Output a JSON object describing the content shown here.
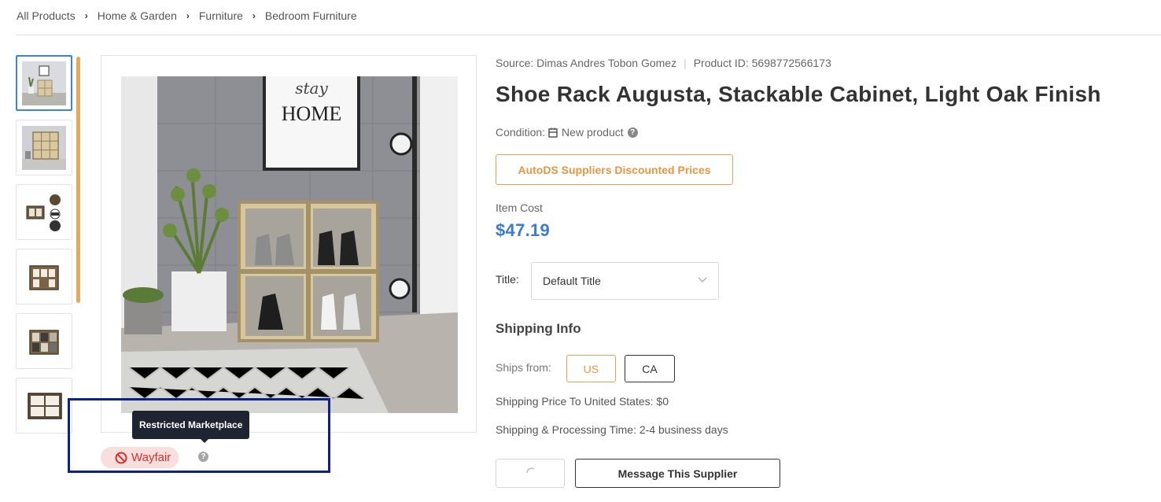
{
  "breadcrumb": {
    "items": [
      "All Products",
      "Home & Garden",
      "Furniture",
      "Bedroom Furniture"
    ],
    "separator": "›"
  },
  "gallery": {
    "thumbnails": [
      {
        "name": "thumbnail-room-scene",
        "icon": "image-icon",
        "active": true
      },
      {
        "name": "thumbnail-room-closeup",
        "icon": "image-icon",
        "active": false
      },
      {
        "name": "thumbnail-parts",
        "icon": "image-icon",
        "active": false
      },
      {
        "name": "thumbnail-front-view",
        "icon": "image-icon",
        "active": false
      },
      {
        "name": "thumbnail-shoes-filled",
        "icon": "image-icon",
        "active": false
      },
      {
        "name": "thumbnail-wide-view",
        "icon": "image-icon",
        "active": false
      }
    ],
    "main_image_poster_text": "HOME",
    "main_image_poster_script": "stay"
  },
  "restriction": {
    "tooltip": "Restricted Marketplace",
    "marketplace": "Wayfair",
    "help": "?"
  },
  "product": {
    "source_label": "Source: Dimas Andres Tobon Gomez",
    "product_id_label": "Product ID: 5698772566173",
    "title": "Shoe Rack Augusta, Stackable Cabinet, Light Oak Finish",
    "condition_label": "Condition:",
    "condition_value": "New product",
    "condition_help": "?",
    "discount_badge": "AutoDS Suppliers Discounted Prices",
    "item_cost_label": "Item Cost",
    "item_cost_value": "$47.19",
    "title_option_label": "Title:",
    "title_option_value": "Default Title"
  },
  "shipping": {
    "heading": "Shipping Info",
    "ships_from_label": "Ships from:",
    "countries": [
      "US",
      "CA"
    ],
    "selected_country": "US",
    "price_text": "Shipping Price To United States:  $0",
    "time_text": "Shipping & Processing Time:  2-4 business days"
  },
  "actions": {
    "message_supplier": "Message This Supplier"
  },
  "colors": {
    "accent_orange": "#e69640",
    "price_blue": "#3a7bd5",
    "restricted_red": "#d9302c",
    "tooltip_bg": "#1f2433",
    "highlight_box": "#0f1f8c"
  }
}
